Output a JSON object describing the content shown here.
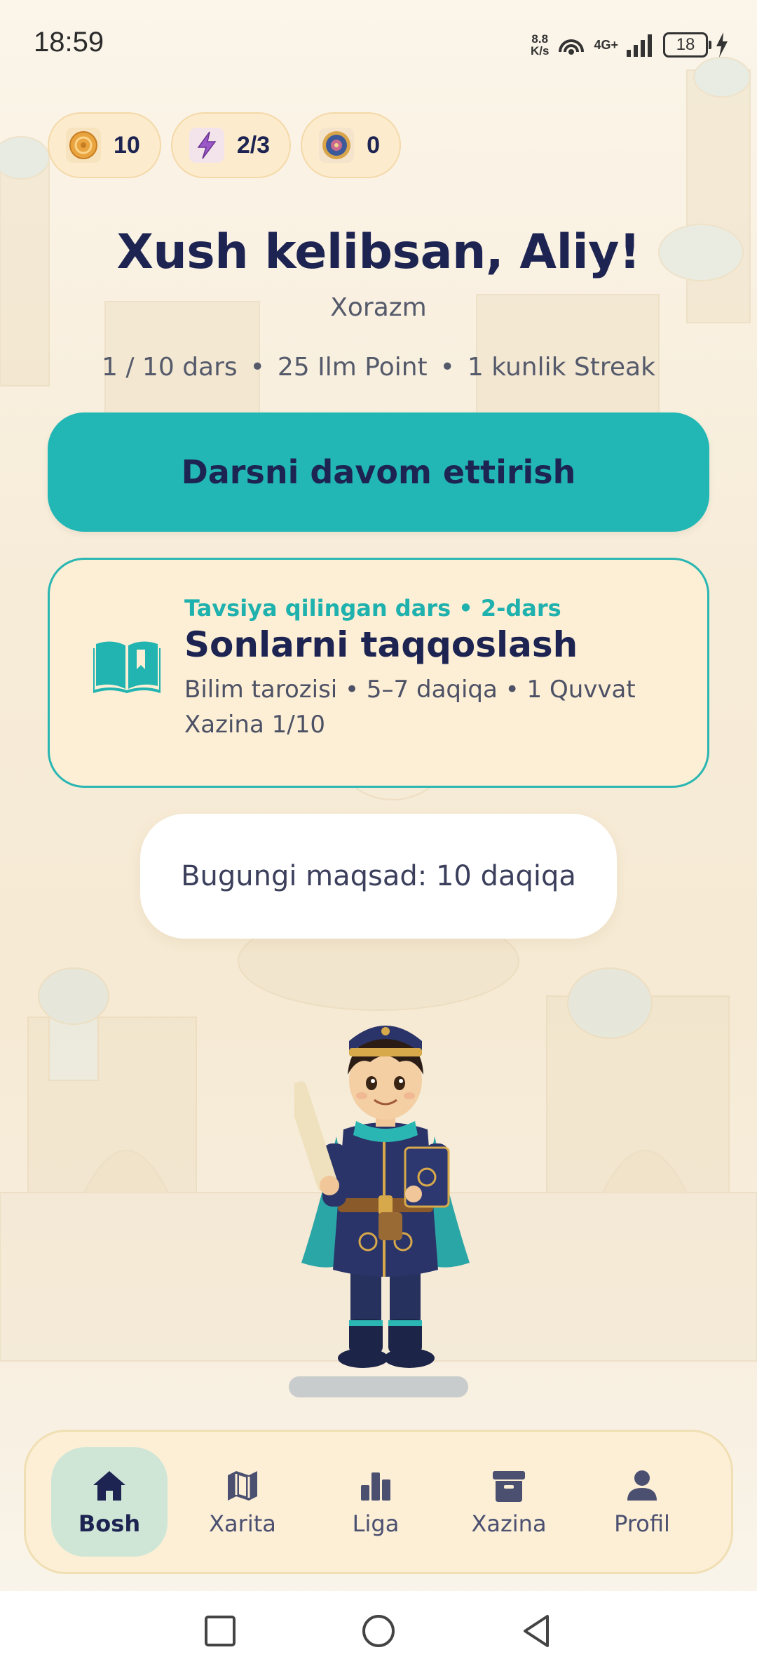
{
  "status_bar": {
    "time": "18:59",
    "net_speed_top": "8.8",
    "net_speed_bottom": "K/s",
    "network": "4G+",
    "battery": "18"
  },
  "currencies": [
    {
      "name": "coins",
      "value": "10",
      "icon": "coin-icon"
    },
    {
      "name": "energy",
      "value": "2/3",
      "icon": "lightning-icon"
    },
    {
      "name": "gems",
      "value": "0",
      "icon": "gem-medallion-icon"
    }
  ],
  "welcome": {
    "title": "Xush kelibsan, Aliy!",
    "region": "Xorazm"
  },
  "stats": {
    "lessons": "1 / 10 dars",
    "points": "25 Ilm Point",
    "streak": "1 kunlik Streak"
  },
  "continue_button": {
    "label": "Darsni davom ettirish"
  },
  "lesson_card": {
    "tag": "Tavsiya qilingan dars • 2-dars",
    "title": "Sonlarni taqqoslash",
    "meta": "Bilim tarozisi • 5–7 daqiqa • 1 Quvvat",
    "treasure": "Xazina 1/10",
    "icon": "open-book-icon"
  },
  "goal": {
    "label": "Bugungi maqsad: 10 daqiqa"
  },
  "bottom_nav": {
    "items": [
      {
        "label": "Bosh",
        "icon": "home-icon",
        "active": true
      },
      {
        "label": "Xarita",
        "icon": "map-icon",
        "active": false
      },
      {
        "label": "Liga",
        "icon": "bar-chart-icon",
        "active": false
      },
      {
        "label": "Xazina",
        "icon": "archive-box-icon",
        "active": false
      },
      {
        "label": "Profil",
        "icon": "person-icon",
        "active": false
      }
    ]
  },
  "colors": {
    "accent": "#22b7b5",
    "navy": "#1d2452",
    "card_bg": "#fcefd6",
    "active_nav": "#cfe6d6"
  }
}
